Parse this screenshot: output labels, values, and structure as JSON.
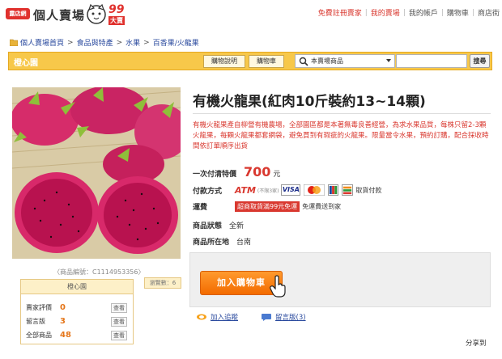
{
  "header": {
    "logo_badge": "露店網",
    "logo_title": "個人賣場",
    "logo_99": "99",
    "logo_99_sub": "大賣",
    "links": [
      "免費註冊賣家",
      "我的賣場",
      "我的帳戶",
      "購物車",
      "商店街"
    ]
  },
  "breadcrumb": [
    "個人賣場首頁",
    "食品與特產",
    "水果",
    "百香果/火龍果"
  ],
  "storebar": {
    "store_name": "橙心園",
    "buy_guide": "購物說明",
    "cart": "購物車",
    "scope_select": "本賣場商品",
    "search_button": "搜尋"
  },
  "product": {
    "title": "有機火龍果(紅肉10斤裝約13~14顆)",
    "description": "有機火龍果產自柳營有機農場，全部園區都是本著無毒良善經營，為求水果品質，每株只留2-3顆火龍果，每顆火龍果都套網袋，避免買到有瑕疵的火龍果。限量當令水果，預約訂購，配合採收時間依訂單順序出貨",
    "price_label": "一次付清特價",
    "price": "700",
    "price_unit": "元",
    "pay_label": "付款方式",
    "atm": "ATM",
    "atm_note": "(不限3家)",
    "pickup": "取貨付款",
    "ship_label": "運費",
    "ship_badge": "超商取貨滿99元免運",
    "ship_note": "免運費送到家",
    "condition_label": "商品狀態",
    "condition": "全新",
    "location_label": "商品所在地",
    "location": "台南",
    "product_id": "〈商品編號：C1114953356〉",
    "add_to_cart": "加入購物車",
    "add_favorite": "加入追蹤",
    "message_board": "留言版(3)",
    "share": "分享到"
  },
  "store_card": {
    "name": "橙心園",
    "browse": "瀏覽數：6",
    "rows": [
      {
        "label": "賣家評價",
        "num": "0",
        "view": "查看"
      },
      {
        "label": "留言版",
        "num": "3",
        "view": "查看"
      },
      {
        "label": "全部商品",
        "num": "48",
        "view": "查看"
      }
    ]
  }
}
